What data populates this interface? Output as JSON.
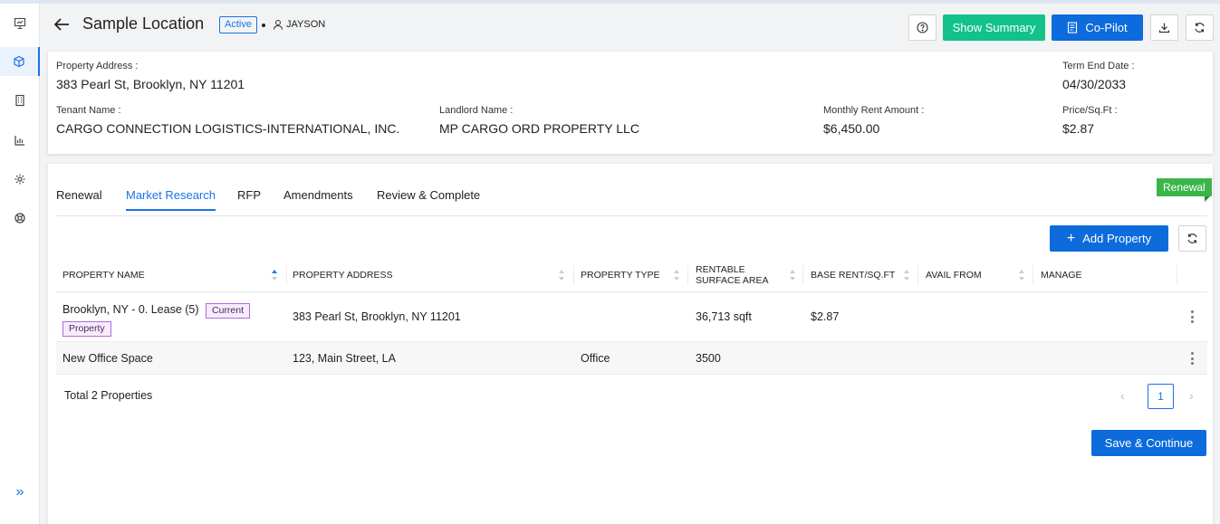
{
  "header": {
    "title": "Sample Location",
    "status": "Active",
    "user": "JAYSON",
    "show_summary": "Show Summary",
    "copilot": "Co-Pilot"
  },
  "info": {
    "property_address_label": "Property Address :",
    "property_address": "383 Pearl St, Brooklyn, NY 11201",
    "term_end_label": "Term End Date :",
    "term_end": "04/30/2033",
    "tenant_label": "Tenant Name :",
    "tenant": "CARGO CONNECTION LOGISTICS-INTERNATIONAL, INC.",
    "landlord_label": "Landlord Name :",
    "landlord": "MP CARGO ORD PROPERTY LLC",
    "rent_label": "Monthly Rent Amount :",
    "rent": "$6,450.00",
    "price_label": "Price/Sq.Ft :",
    "price": "$2.87"
  },
  "tabs": [
    "Renewal",
    "Market Research",
    "RFP",
    "Amendments",
    "Review & Complete"
  ],
  "active_tab": "Market Research",
  "ribbon": "Renewal",
  "add_property": "Add Property",
  "table": {
    "columns": [
      "PROPERTY NAME",
      "PROPERTY ADDRESS",
      "PROPERTY TYPE",
      "RENTABLE SURFACE AREA",
      "BASE RENT/SQ.FT",
      "AVAIL FROM",
      "MANAGE"
    ],
    "col_rentable_1": "RENTABLE",
    "col_rentable_2": "SURFACE AREA",
    "rows": [
      {
        "name": "Brooklyn, NY - 0. Lease (5)",
        "tag_1": "Current",
        "tag_2": "Property",
        "address": "383 Pearl St, Brooklyn, NY 11201",
        "type": "",
        "area": "36,713 sqft",
        "rent": "$2.87",
        "avail": ""
      },
      {
        "name": "New Office Space",
        "address": "123, Main Street, LA",
        "type": "Office",
        "area": "3500",
        "rent": "",
        "avail": ""
      }
    ]
  },
  "total": "Total 2 Properties",
  "pagination": {
    "page": "1"
  },
  "save_continue": "Save & Continue",
  "icons": {
    "sidebar": [
      "presentation-icon",
      "cube-icon",
      "building-icon",
      "bar-chart-icon",
      "gear-icon",
      "support-icon"
    ],
    "expand": "double-chevron-right-icon"
  },
  "colors": {
    "primary": "#0d6bdc",
    "success": "#12c28a",
    "ribbon": "#3bb54a",
    "tag": "#b06ad8"
  }
}
